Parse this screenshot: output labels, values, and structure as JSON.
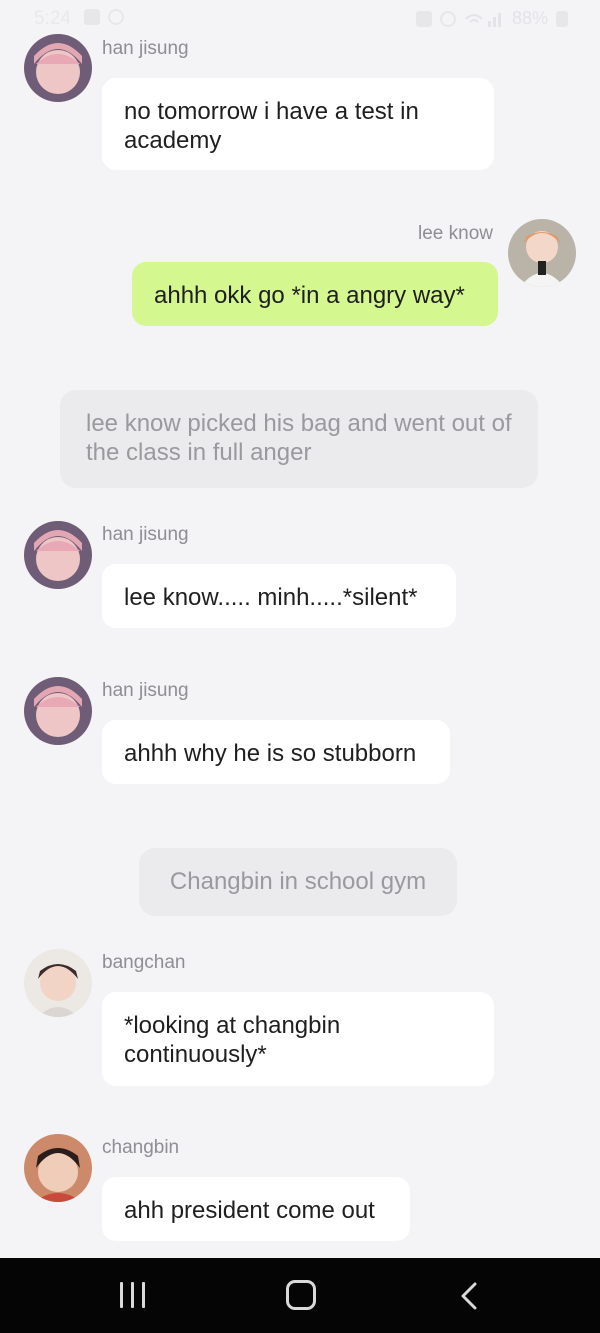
{
  "status_bar": {
    "time": "5:24",
    "battery": "88%"
  },
  "messages": [
    {
      "kind": "other",
      "name": "han jisung",
      "avatar": "han-jisung-avatar",
      "text": "no tomorrow i have a test in academy"
    },
    {
      "kind": "self",
      "name": "lee know",
      "avatar": "lee-know-avatar",
      "text": "ahhh okk go *in a angry way*"
    },
    {
      "kind": "narration",
      "text": "lee know picked his bag and went out of the class in full anger"
    },
    {
      "kind": "other",
      "name": "han jisung",
      "avatar": "han-jisung-avatar",
      "text": "lee know..... minh.....*silent*"
    },
    {
      "kind": "other",
      "name": "han jisung",
      "avatar": "han-jisung-avatar",
      "text": "ahhh why he is so stubborn"
    },
    {
      "kind": "narration",
      "text": "Changbin in school gym"
    },
    {
      "kind": "other",
      "name": "bangchan",
      "avatar": "bangchan-avatar",
      "text": "*looking at changbin continuously*"
    },
    {
      "kind": "other",
      "name": "changbin",
      "avatar": "changbin-avatar",
      "text": "ahh president come out"
    }
  ],
  "colors": {
    "background": "#f4f4f6",
    "bubble_other": "#ffffff",
    "bubble_self": "#d5f78f",
    "narration_bg": "#ebebed",
    "name_text": "#8e8e93"
  },
  "nav_bar": {
    "icons": [
      "recents-icon",
      "home-icon",
      "back-icon"
    ]
  }
}
